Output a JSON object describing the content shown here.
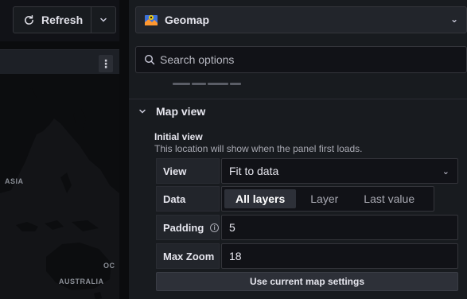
{
  "toolbar": {
    "refresh_label": "Refresh",
    "refresh_icon": "refresh-icon",
    "caret_icon": "chevron-down-icon"
  },
  "map": {
    "menu_icon": "kebab-menu-icon",
    "labels": {
      "asia": "ASIA",
      "australia": "AUSTRALIA",
      "oc": "OC"
    }
  },
  "options": {
    "visualization": "Geomap",
    "visualization_icon": "geomap-icon",
    "search_placeholder": "Search options",
    "section": {
      "title": "Map view",
      "subtitle": "Initial view",
      "description": "This location will show when the panel first loads."
    },
    "fields": {
      "view": {
        "label": "View",
        "value": "Fit to data"
      },
      "data": {
        "label": "Data",
        "options": [
          "All layers",
          "Layer",
          "Last value"
        ],
        "selected": "All layers"
      },
      "padding": {
        "label": "Padding",
        "value": "5"
      },
      "max_zoom": {
        "label": "Max Zoom",
        "value": "18"
      }
    },
    "use_current_button": "Use current map settings"
  },
  "colors": {
    "background": "#0b0c0e",
    "panel": "#181b1f",
    "input": "#111217",
    "border": "#34353b",
    "active_tab": "#2d3038"
  }
}
